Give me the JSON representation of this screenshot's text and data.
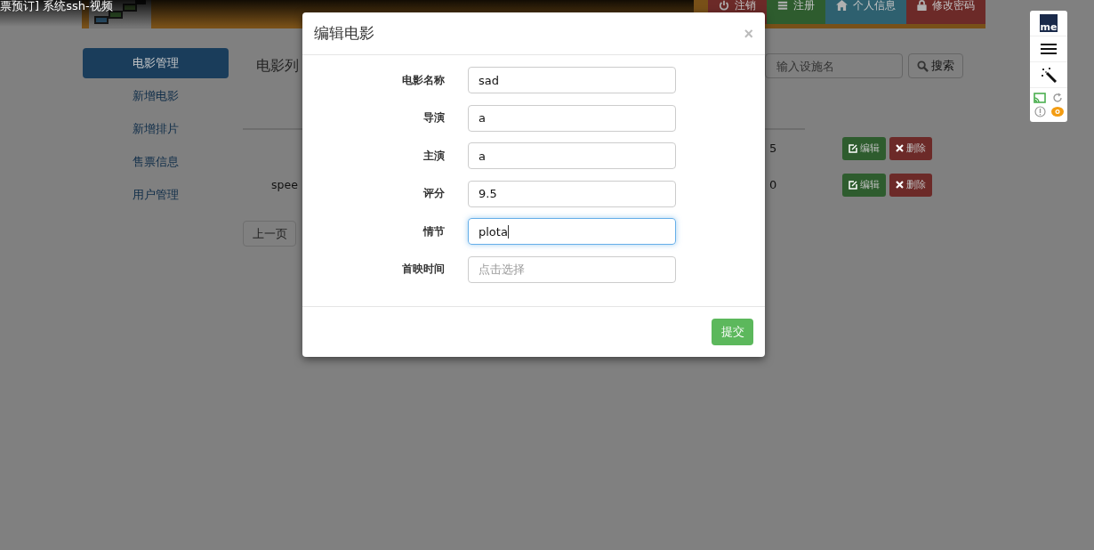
{
  "video_title": "票预订] 系统ssh-视频",
  "header": {
    "nav_buttons": [
      {
        "label": "注销",
        "color": "#6c2a28"
      },
      {
        "label": "注册",
        "color": "#2e5c2e"
      },
      {
        "label": "个人信息",
        "color": "#2e606f"
      },
      {
        "label": "修改密码",
        "color": "#6c2a28"
      }
    ]
  },
  "sidebar": {
    "items": [
      {
        "label": "电影管理",
        "selected": true
      },
      {
        "label": "新增电影",
        "selected": false
      },
      {
        "label": "新增排片",
        "selected": false
      },
      {
        "label": "售票信息",
        "selected": false
      },
      {
        "label": "用户管理",
        "selected": false
      }
    ]
  },
  "content": {
    "title": "电影列",
    "search": {
      "placeholder": "输入设施名"
    },
    "search_button": "搜索",
    "table": {
      "rows": [
        {
          "column_4": "5",
          "actions": [
            "编辑",
            "删除"
          ]
        },
        {
          "column_1": "spee",
          "column_4": "0",
          "actions": [
            "编辑",
            "删除"
          ]
        }
      ]
    },
    "pagination": [
      "上一页"
    ]
  },
  "extension_bar": {
    "logo": "me"
  },
  "modal": {
    "title": "编辑电影",
    "close": "×",
    "fields": [
      {
        "label": "电影名称",
        "value": "sad",
        "focused": false
      },
      {
        "label": "导演",
        "value": "a",
        "focused": false
      },
      {
        "label": "主演",
        "value": "a",
        "focused": false
      },
      {
        "label": "评分",
        "value": "9.5",
        "focused": false
      },
      {
        "label": "情节",
        "value": "plota",
        "focused": true
      },
      {
        "label": "首映时间",
        "placeholder": "点击选择",
        "focused": false
      }
    ],
    "submit": "提交"
  }
}
